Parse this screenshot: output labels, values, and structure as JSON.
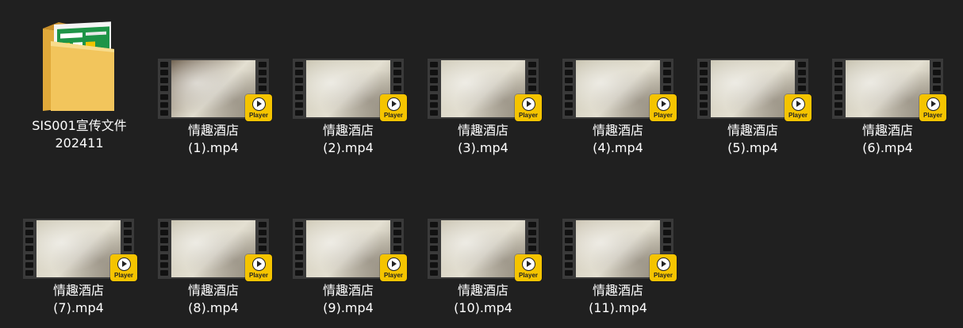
{
  "colors": {
    "background": "#202020",
    "label_text": "#ffffff",
    "player_badge": "#f5c400",
    "film_strip": "#3a3a3a",
    "folder": "#f2c55c",
    "flyer_green": "#1e9447"
  },
  "folder": {
    "name_line1": "SIS001宣传文件",
    "name_line2": "202411",
    "icon": "folder-icon"
  },
  "player_badge_label": "Player",
  "files": [
    {
      "line1": "情趣酒店",
      "line2": "(1).mp4",
      "tone": "#6b5c4a"
    },
    {
      "line1": "情趣酒店",
      "line2": "(2).mp4",
      "tone": "#c9c4b0"
    },
    {
      "line1": "情趣酒店",
      "line2": "(3).mp4",
      "tone": "#cfcab8"
    },
    {
      "line1": "情趣酒店",
      "line2": "(4).mp4",
      "tone": "#c7c2ae"
    },
    {
      "line1": "情趣酒店",
      "line2": "(5).mp4",
      "tone": "#cbc6b4"
    },
    {
      "line1": "情趣酒店",
      "line2": "(6).mp4",
      "tone": "#c5c0ad"
    },
    {
      "line1": "情趣酒店",
      "line2": "(7).mp4",
      "tone": "#cdc8b6"
    },
    {
      "line1": "情趣酒店",
      "line2": "(8).mp4",
      "tone": "#c8c3b0"
    },
    {
      "line1": "情趣酒店",
      "line2": "(9).mp4",
      "tone": "#cfc9b6"
    },
    {
      "line1": "情趣酒店",
      "line2": "(10).mp4",
      "tone": "#c9c3b1"
    },
    {
      "line1": "情趣酒店",
      "line2": "(11).mp4",
      "tone": "#cbc4b2"
    }
  ]
}
